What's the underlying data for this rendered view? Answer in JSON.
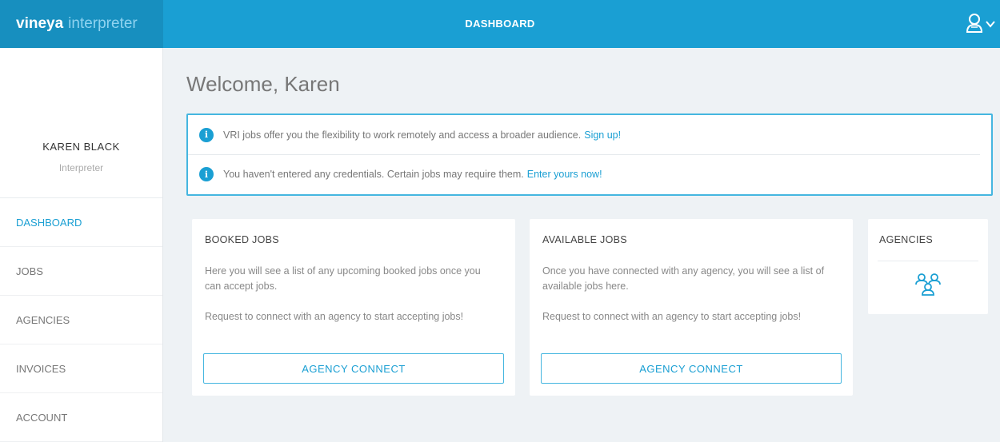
{
  "header": {
    "brand_bold": "vineya",
    "brand_light": "interpreter",
    "title": "DASHBOARD",
    "user_icon": "user-icon",
    "menu_icon": "chevron-down-icon"
  },
  "sidebar": {
    "profile_name": "KAREN BLACK",
    "profile_role": "Interpreter",
    "items": [
      {
        "label": "DASHBOARD",
        "active": true
      },
      {
        "label": "JOBS",
        "active": false
      },
      {
        "label": "AGENCIES",
        "active": false
      },
      {
        "label": "INVOICES",
        "active": false
      },
      {
        "label": "ACCOUNT",
        "active": false
      }
    ]
  },
  "main": {
    "welcome": "Welcome, Karen",
    "alerts": [
      {
        "icon": "info-icon",
        "text": "VRI jobs offer you the flexibility to work remotely and access a broader audience.",
        "link": "Sign up!"
      },
      {
        "icon": "info-icon",
        "text": "You haven't entered any credentials. Certain jobs may require them.",
        "link": "Enter yours now!"
      }
    ],
    "booked": {
      "title": "BOOKED JOBS",
      "text1": "Here you will see a list of any upcoming booked jobs once you can accept jobs.",
      "text2": "Request to connect with an agency to start accepting jobs!",
      "button": "AGENCY CONNECT"
    },
    "available": {
      "title": "AVAILABLE JOBS",
      "text1": "Once you have connected with any agency, you will see a list of available jobs here.",
      "text2": "Request to connect with an agency to start accepting jobs!",
      "button": "AGENCY CONNECT"
    },
    "agencies": {
      "title": "AGENCIES",
      "icon": "agency-group-icon"
    }
  },
  "colors": {
    "accent": "#1a9fd3",
    "brand_bg": "#178fbf",
    "page_bg": "#eef2f5"
  }
}
